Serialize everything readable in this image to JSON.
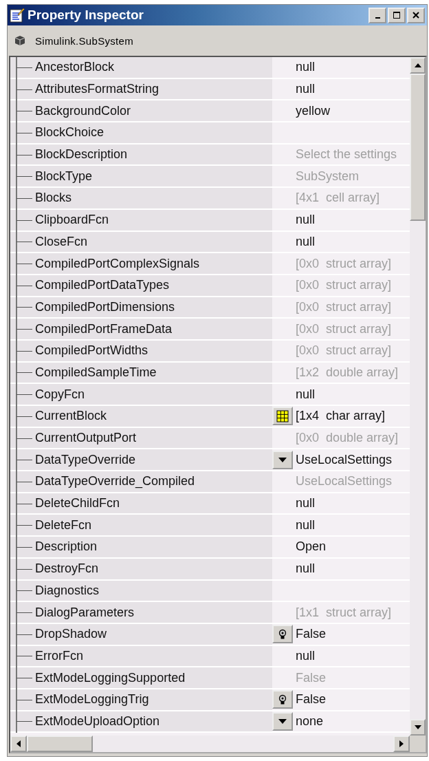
{
  "window": {
    "title": "Property Inspector"
  },
  "object": {
    "label": "Simulink.SubSystem"
  },
  "properties": [
    {
      "name": "AncestorBlock",
      "value": "null",
      "readonly": false
    },
    {
      "name": "AttributesFormatString",
      "value": "null",
      "readonly": false
    },
    {
      "name": "BackgroundColor",
      "value": "yellow",
      "readonly": false
    },
    {
      "name": "BlockChoice"
    },
    {
      "name": "BlockDescription",
      "value": "Select the settings",
      "readonly": true
    },
    {
      "name": "BlockType",
      "value": "SubSystem",
      "readonly": true
    },
    {
      "name": "Blocks",
      "value": "[4x1  cell array]",
      "readonly": true
    },
    {
      "name": "ClipboardFcn",
      "value": "null",
      "readonly": false
    },
    {
      "name": "CloseFcn",
      "value": "null",
      "readonly": false
    },
    {
      "name": "CompiledPortComplexSignals",
      "value": "[0x0  struct array]",
      "readonly": true
    },
    {
      "name": "CompiledPortDataTypes",
      "value": "[0x0  struct array]",
      "readonly": true
    },
    {
      "name": "CompiledPortDimensions",
      "value": "[0x0  struct array]",
      "readonly": true
    },
    {
      "name": "CompiledPortFrameData",
      "value": "[0x0  struct array]",
      "readonly": true
    },
    {
      "name": "CompiledPortWidths",
      "value": "[0x0  struct array]",
      "readonly": true
    },
    {
      "name": "CompiledSampleTime",
      "value": "[1x2  double array]",
      "readonly": true
    },
    {
      "name": "CopyFcn",
      "value": "null",
      "readonly": false
    },
    {
      "name": "CurrentBlock",
      "value": "[1x4  char array]",
      "readonly": false,
      "kind": "grid"
    },
    {
      "name": "CurrentOutputPort",
      "value": "[0x0  double array]",
      "readonly": true
    },
    {
      "name": "DataTypeOverride",
      "value": "UseLocalSettings",
      "readonly": false,
      "kind": "dropdown"
    },
    {
      "name": "DataTypeOverride_Compiled",
      "value": "UseLocalSettings",
      "readonly": true
    },
    {
      "name": "DeleteChildFcn",
      "value": "null",
      "readonly": false
    },
    {
      "name": "DeleteFcn",
      "value": "null",
      "readonly": false
    },
    {
      "name": "Description",
      "value": "Open",
      "readonly": false
    },
    {
      "name": "DestroyFcn",
      "value": "null",
      "readonly": false
    },
    {
      "name": "Diagnostics"
    },
    {
      "name": "DialogParameters",
      "value": "[1x1  struct array]",
      "readonly": true
    },
    {
      "name": "DropShadow",
      "value": "False",
      "readonly": false,
      "kind": "toggle"
    },
    {
      "name": "ErrorFcn",
      "value": "null",
      "readonly": false
    },
    {
      "name": "ExtModeLoggingSupported",
      "value": "False",
      "readonly": true
    },
    {
      "name": "ExtModeLoggingTrig",
      "value": "False",
      "readonly": false,
      "kind": "toggle"
    },
    {
      "name": "ExtModeUploadOption",
      "value": "none",
      "readonly": false,
      "kind": "dropdown"
    }
  ]
}
